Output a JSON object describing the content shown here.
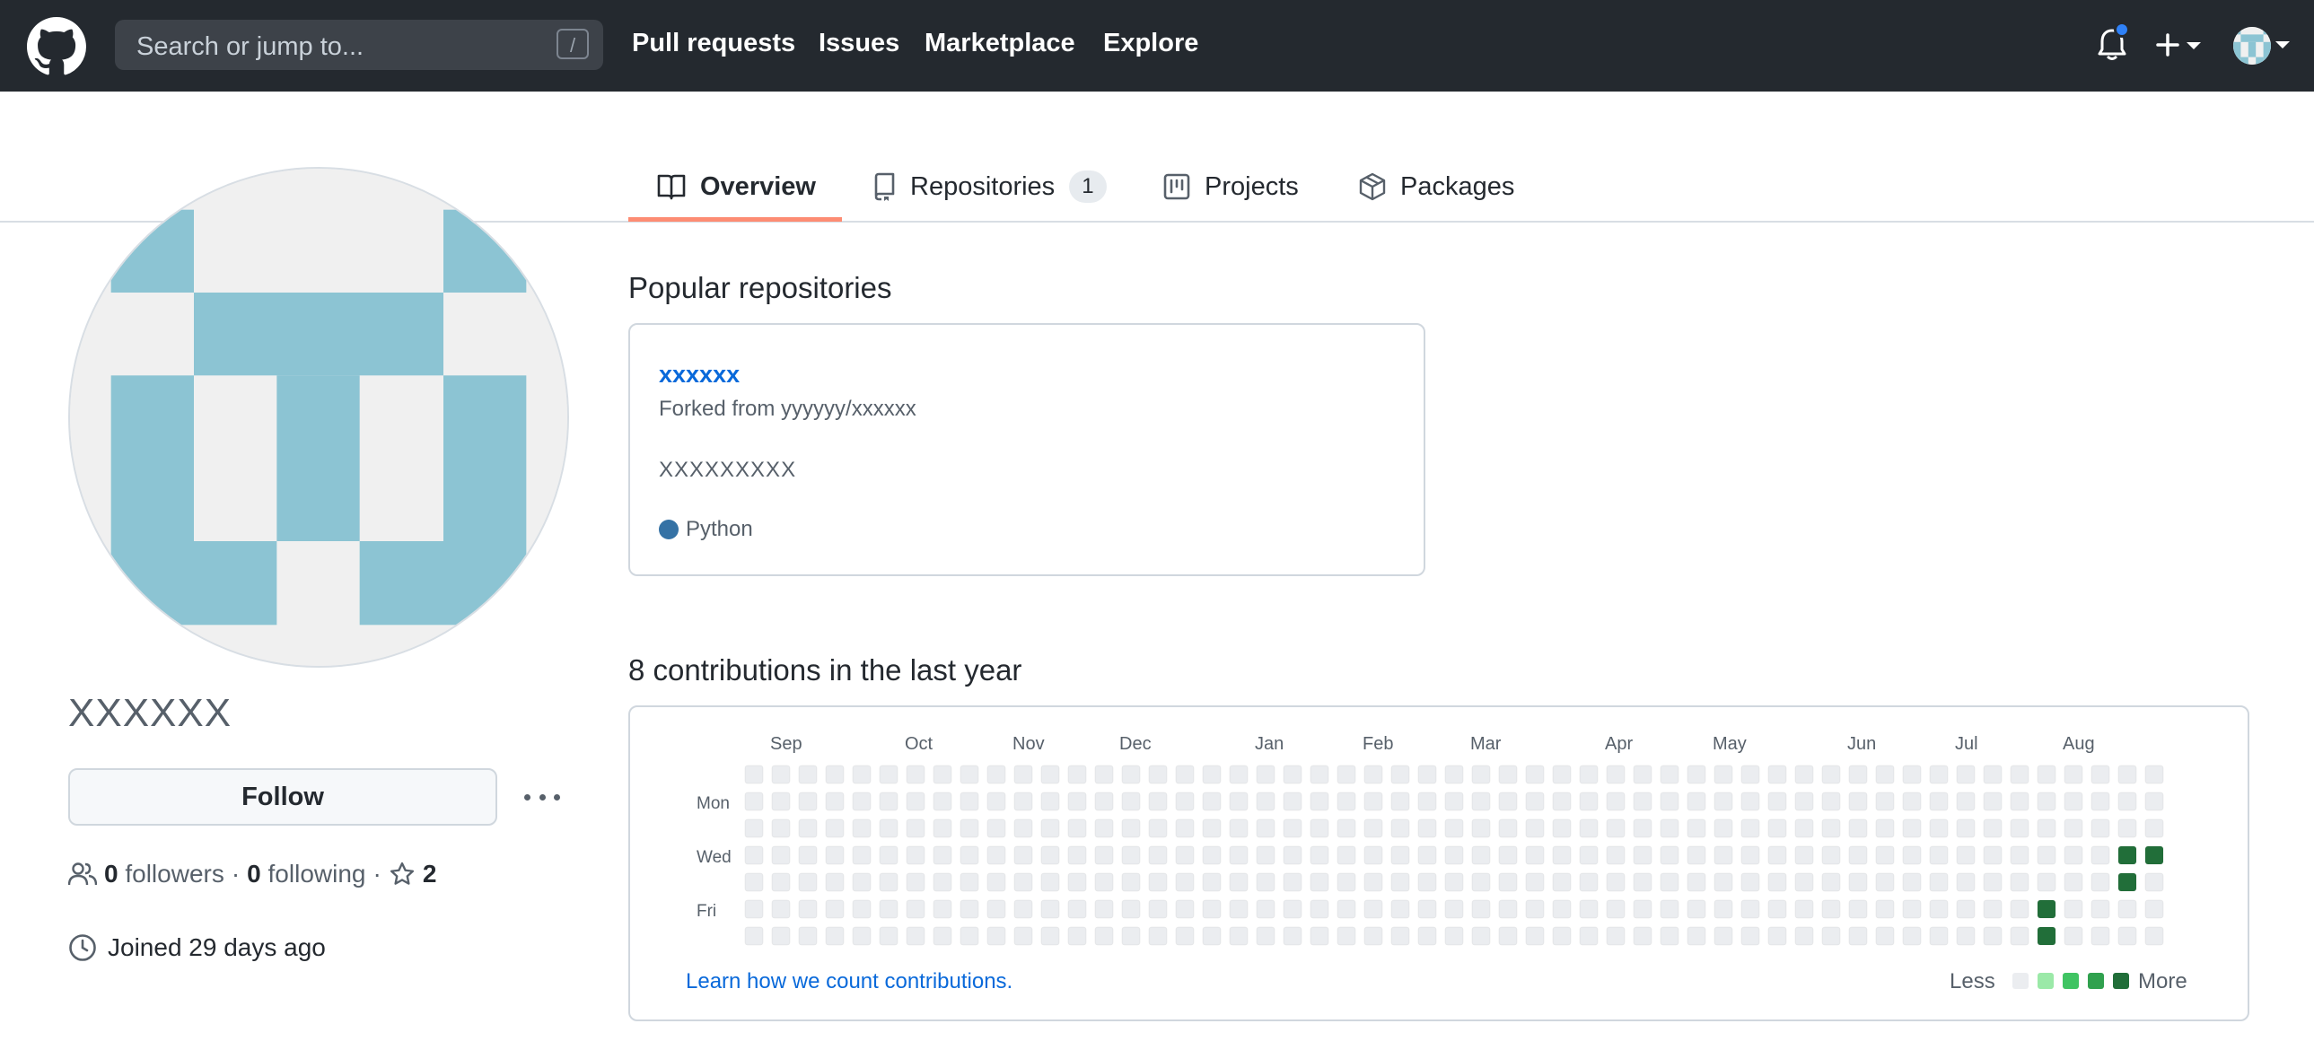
{
  "header": {
    "search_placeholder": "Search or jump to...",
    "search_shortcut": "/",
    "nav": [
      "Pull requests",
      "Issues",
      "Marketplace",
      "Explore"
    ]
  },
  "tabs": [
    {
      "label": "Overview",
      "icon": "book-icon",
      "active": true
    },
    {
      "label": "Repositories",
      "icon": "repo-icon",
      "counter": "1"
    },
    {
      "label": "Projects",
      "icon": "project-icon"
    },
    {
      "label": "Packages",
      "icon": "package-icon"
    }
  ],
  "profile": {
    "name": "XXXXXX",
    "follow_label": "Follow",
    "followers_count": "0",
    "followers_label": "followers",
    "following_count": "0",
    "following_label": "following",
    "stars_count": "2",
    "joined": "Joined 29 days ago"
  },
  "popular": {
    "title": "Popular repositories",
    "repo": {
      "name": "xxxxxx",
      "forked_from": "Forked from yyyyyy/xxxxxx",
      "description": "XXXXXXXXX",
      "language": "Python",
      "language_color": "#3572a5"
    }
  },
  "contributions": {
    "title": "8 contributions in the last year",
    "months": [
      "Sep",
      "Oct",
      "Nov",
      "Dec",
      "Jan",
      "Feb",
      "Mar",
      "Apr",
      "May",
      "Jun",
      "Jul",
      "Aug"
    ],
    "day_labels": [
      "Mon",
      "Wed",
      "Fri"
    ],
    "learn_link": "Learn how we count contributions.",
    "legend_less": "Less",
    "legend_more": "More",
    "colors": [
      "#ebedf0",
      "#9be9a8",
      "#40c463",
      "#30a14e",
      "#216e39"
    ],
    "active_cells": [
      {
        "week": 48,
        "day": 5,
        "level": 4
      },
      {
        "week": 48,
        "day": 6,
        "level": 4
      },
      {
        "week": 51,
        "day": 3,
        "level": 4
      },
      {
        "week": 51,
        "day": 4,
        "level": 4
      },
      {
        "week": 52,
        "day": 3,
        "level": 4
      }
    ]
  }
}
